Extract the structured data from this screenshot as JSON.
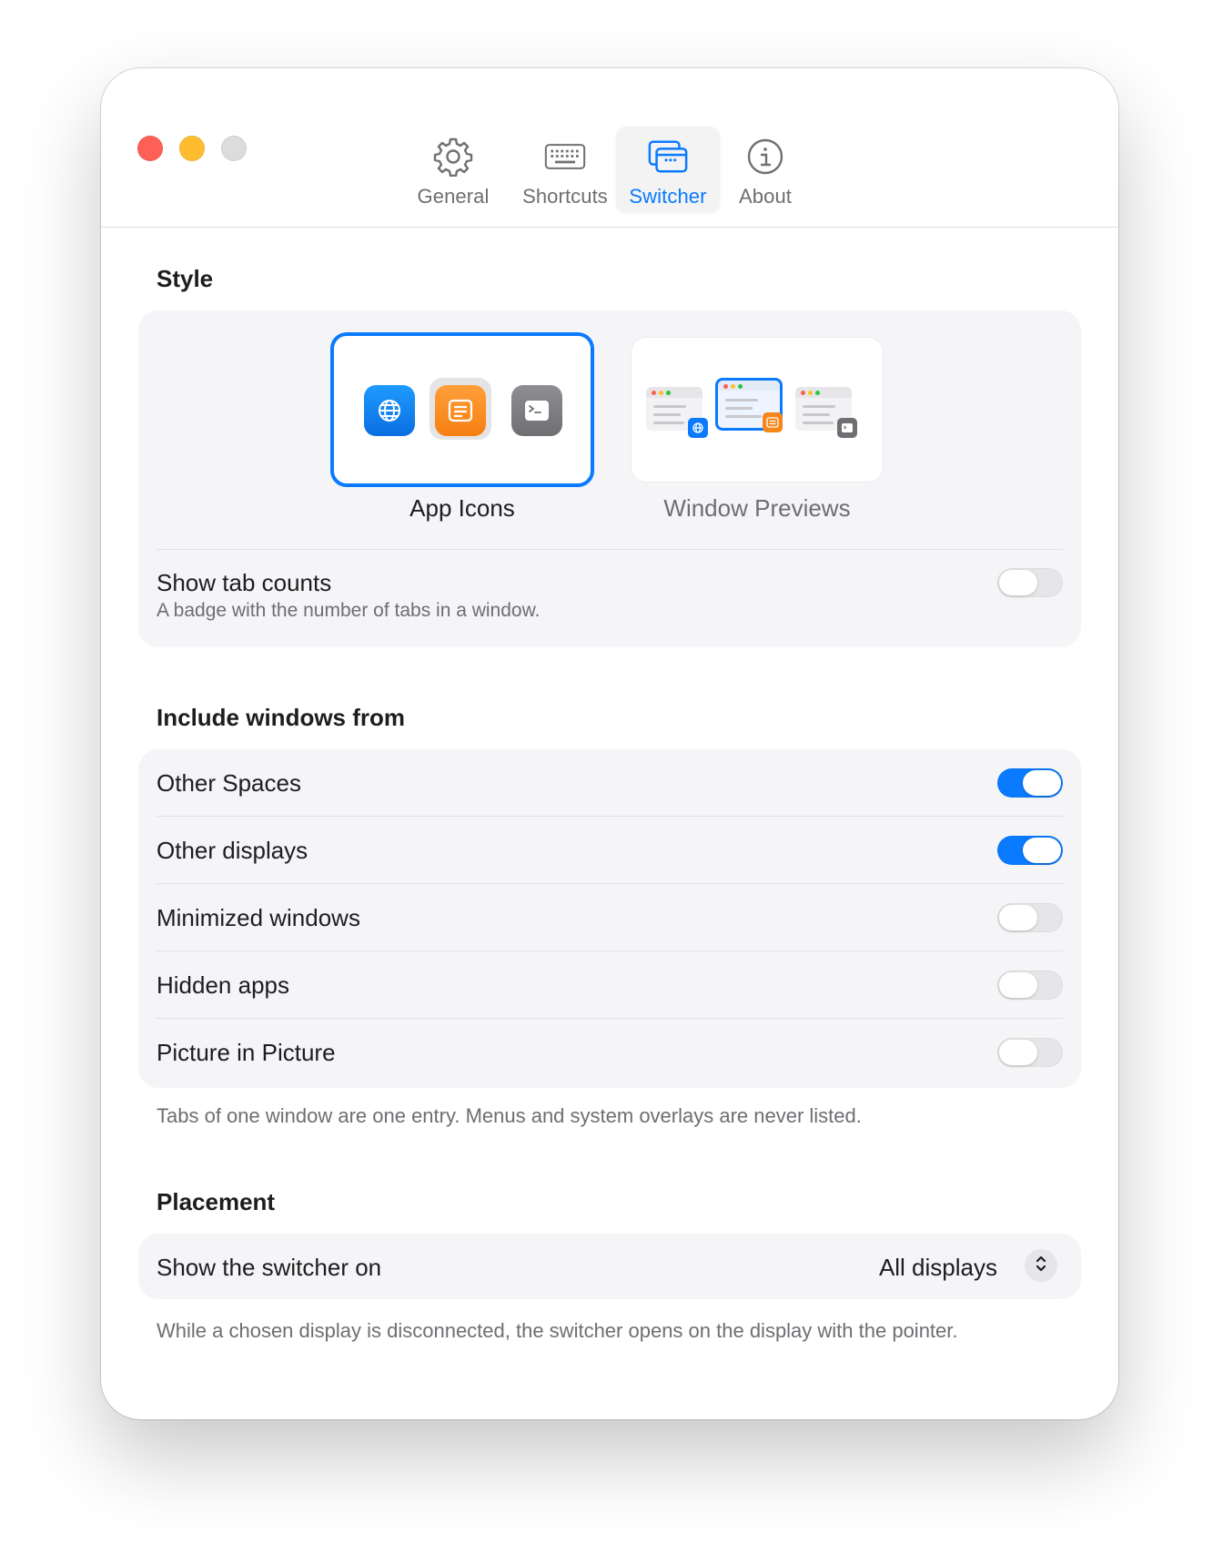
{
  "tabs": [
    {
      "label": "General",
      "icon": "gear-icon"
    },
    {
      "label": "Shortcuts",
      "icon": "keyboard-icon"
    },
    {
      "label": "Switcher",
      "icon": "windows-icon",
      "active": true
    },
    {
      "label": "About",
      "icon": "info-icon"
    }
  ],
  "style": {
    "title": "Style",
    "option_icons_label": "App Icons",
    "option_previews_label": "Window Previews",
    "selected": "App Icons",
    "tab_counts_label": "Show tab counts",
    "tab_counts_desc": "A badge with the number of tabs in a window.",
    "tab_counts_on": false
  },
  "include": {
    "title": "Include windows from",
    "rows": [
      {
        "label": "Other Spaces",
        "on": true
      },
      {
        "label": "Other displays",
        "on": true
      },
      {
        "label": "Minimized windows",
        "on": false
      },
      {
        "label": "Hidden apps",
        "on": false
      },
      {
        "label": "Picture in Picture",
        "on": false
      }
    ],
    "footnote": "Tabs of one window are one entry. Menus and system overlays are never listed."
  },
  "placement": {
    "title": "Placement",
    "show_on_label": "Show the switcher on",
    "show_on_value": "All displays",
    "footnote": "While a chosen display is disconnected, the switcher opens on the display with the pointer."
  },
  "colors": {
    "accent": "#0a7aff",
    "close": "#fe5f57",
    "minimize": "#febc2e",
    "zoom": "#dcdcdc"
  }
}
